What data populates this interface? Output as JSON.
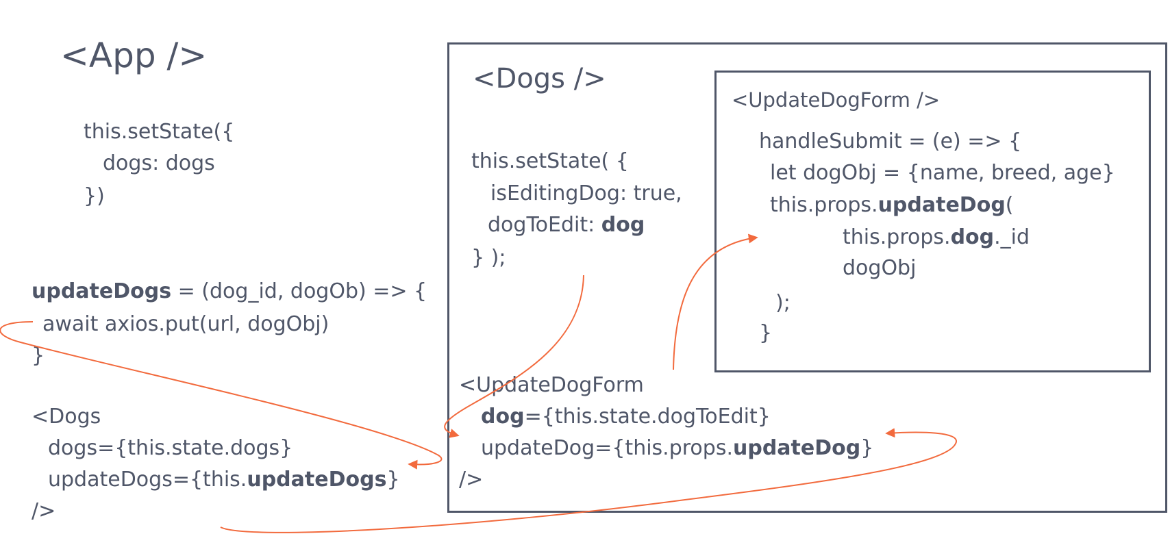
{
  "app": {
    "title": "<App />",
    "setstate": [
      "this.setState({",
      "dogs: dogs",
      "})"
    ],
    "update_fn": {
      "l1_name": "updateDogs",
      "l1_rest": " = (dog_id, dogOb) => {",
      "l2": "await axios.put(url, dogObj)",
      "l3": "}"
    },
    "dogs_el": {
      "l1": "<Dogs",
      "l2": "dogs={this.state.dogs}",
      "l3_pre": "updateDogs={this.",
      "l3_bold": "updateDogs",
      "l3_post": "}",
      "l4": "/>"
    }
  },
  "dogs": {
    "title": "<Dogs />",
    "setstate": {
      "l1": "this.setState( {",
      "l2": "isEditingDog: true,",
      "l3_pre": "dogToEdit: ",
      "l3_bold": "dog",
      "l4": "} );"
    },
    "form_el": {
      "l1": "<UpdateDogForm",
      "l2_bold": "dog",
      "l2_rest": "={this.state.dogToEdit}",
      "l3_pre": "updateDog={this.props.",
      "l3_bold": "updateDog",
      "l3_post": "}",
      "l4": "/>"
    }
  },
  "form": {
    "title": "<UpdateDogForm />",
    "l1": "handleSubmit = (e) => {",
    "l2": "let dogObj = {name, breed, age}",
    "l3_pre": "this.props.",
    "l3_bold": "updateDog",
    "l3_post": "(",
    "l4_pre": "this.props.",
    "l4_bold": "dog",
    "l4_post": "._id",
    "l5": "dogObj",
    "l6": ");",
    "l7": "}"
  },
  "colors": {
    "text": "#4f5668",
    "arrow": "#f26a3d",
    "border": "#4f5668"
  }
}
